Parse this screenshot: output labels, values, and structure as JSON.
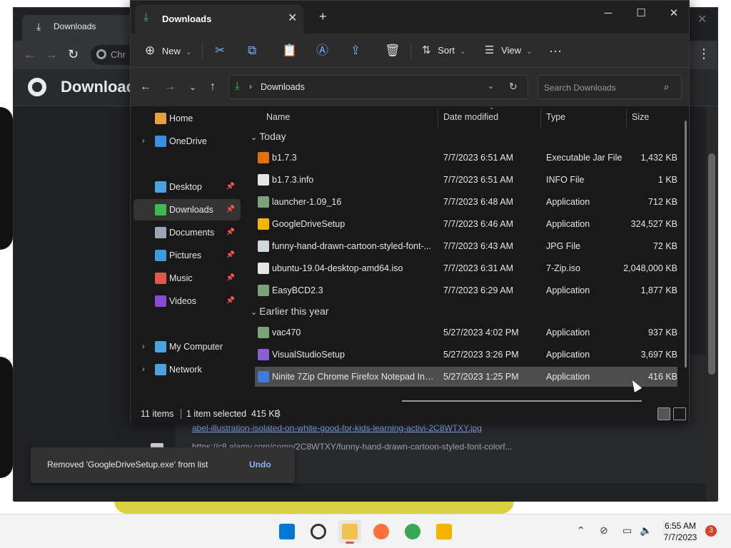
{
  "chrome": {
    "tab_title": "Downloads",
    "omnibox_text": "Chr",
    "page_title": "Download",
    "download_item": {
      "filename": "abel-illustration-isolated-on-white-good-for-kids-learning-activi-2C8WTXY.jpg",
      "url": "https://c8.alamy.com/comp/2C8WTXY/funny-hand-drawn-cartoon-styled-font-colorf..."
    }
  },
  "snackbar": {
    "text": "Removed 'GoogleDriveSetup.exe' from list",
    "action": "Undo"
  },
  "explorer": {
    "tab_title": "Downloads",
    "commands": {
      "new": "New",
      "sort": "Sort",
      "view": "View"
    },
    "address": "Downloads",
    "search_placeholder": "Search Downloads",
    "nav": [
      {
        "label": "Home",
        "icon": "home-icon",
        "pinned": false,
        "expandable": false
      },
      {
        "label": "OneDrive",
        "icon": "cloud-icon",
        "pinned": false,
        "expandable": true
      },
      {
        "label": "Desktop",
        "icon": "desktop-icon",
        "pinned": true,
        "expandable": false
      },
      {
        "label": "Downloads",
        "icon": "download-icon",
        "pinned": true,
        "expandable": false,
        "selected": true
      },
      {
        "label": "Documents",
        "icon": "document-icon",
        "pinned": true,
        "expandable": false
      },
      {
        "label": "Pictures",
        "icon": "picture-icon",
        "pinned": true,
        "expandable": false
      },
      {
        "label": "Music",
        "icon": "music-icon",
        "pinned": true,
        "expandable": false
      },
      {
        "label": "Videos",
        "icon": "video-icon",
        "pinned": true,
        "expandable": false
      },
      {
        "label": "My Computer",
        "icon": "computer-icon",
        "pinned": false,
        "expandable": true
      },
      {
        "label": "Network",
        "icon": "network-icon",
        "pinned": false,
        "expandable": true
      }
    ],
    "columns": {
      "name": "Name",
      "date": "Date modified",
      "type": "Type",
      "size": "Size"
    },
    "groups": [
      {
        "label": "Today",
        "files": [
          {
            "name": "b1.7.3",
            "date": "7/7/2023 6:51 AM",
            "type": "Executable Jar File",
            "size": "1,432 KB",
            "icon": "java-icon"
          },
          {
            "name": "b1.7.3.info",
            "date": "7/7/2023 6:51 AM",
            "type": "INFO File",
            "size": "1 KB",
            "icon": "file-icon"
          },
          {
            "name": "launcher-1.09_16",
            "date": "7/7/2023 6:48 AM",
            "type": "Application",
            "size": "712 KB",
            "icon": "app-icon"
          },
          {
            "name": "GoogleDriveSetup",
            "date": "7/7/2023 6:46 AM",
            "type": "Application",
            "size": "324,527 KB",
            "icon": "google-drive-icon"
          },
          {
            "name": "funny-hand-drawn-cartoon-styled-font-...",
            "date": "7/7/2023 6:43 AM",
            "type": "JPG File",
            "size": "72 KB",
            "icon": "image-file-icon"
          },
          {
            "name": "ubuntu-19.04-desktop-amd64.iso",
            "date": "7/7/2023 6:31 AM",
            "type": "7-Zip.iso",
            "size": "2,048,000 KB",
            "icon": "file-icon"
          },
          {
            "name": "EasyBCD2.3",
            "date": "7/7/2023 6:29 AM",
            "type": "Application",
            "size": "1,877 KB",
            "icon": "app-icon"
          }
        ]
      },
      {
        "label": "Earlier this year",
        "files": [
          {
            "name": "vac470",
            "date": "5/27/2023 4:02 PM",
            "type": "Application",
            "size": "937 KB",
            "icon": "app-icon"
          },
          {
            "name": "VisualStudioSetup",
            "date": "5/27/2023 3:26 PM",
            "type": "Application",
            "size": "3,697 KB",
            "icon": "visual-studio-icon"
          },
          {
            "name": "Ninite 7Zip Chrome Firefox Notepad Inst...",
            "date": "5/27/2023 1:25 PM",
            "type": "Application",
            "size": "416 KB",
            "icon": "ninite-icon",
            "selected": true
          }
        ]
      }
    ],
    "status": {
      "item_count": "11 items",
      "selection": "1 item selected  415 KB"
    }
  },
  "taskbar": {
    "apps": [
      "start-icon",
      "search-icon",
      "file-explorer-icon",
      "firefox-icon",
      "chrome-icon",
      "google-drive-icon"
    ],
    "time": "6:55 AM",
    "date": "7/7/2023",
    "notification_count": "3"
  }
}
